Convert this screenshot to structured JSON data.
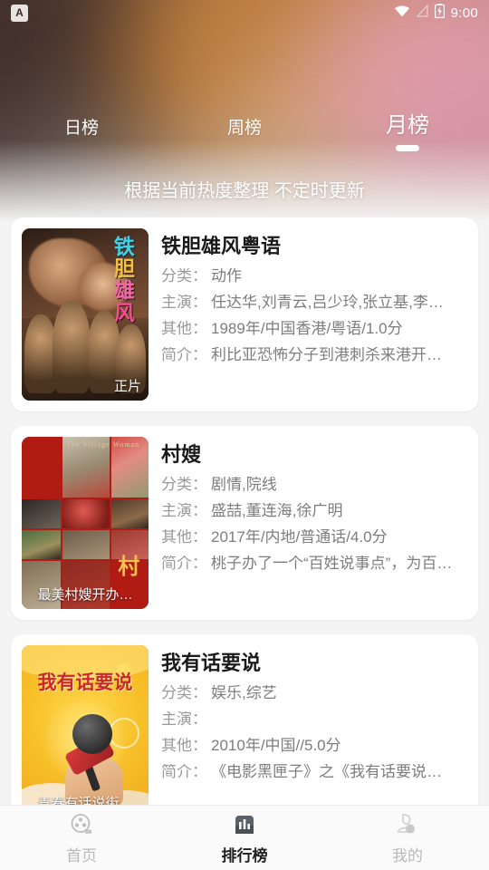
{
  "status_bar": {
    "app_badge": "A",
    "time": "9:00",
    "icons": [
      "wifi-icon",
      "signal-icon",
      "battery-charging-icon"
    ]
  },
  "header": {
    "tabs": [
      {
        "label": "日榜",
        "active": false
      },
      {
        "label": "周榜",
        "active": false
      },
      {
        "label": "月榜",
        "active": true
      }
    ],
    "subtitle": "根据当前热度整理 不定时更新"
  },
  "list": {
    "labels": {
      "category": "分类：",
      "cast": "主演：",
      "other": "其他：",
      "summary": "简介："
    },
    "items": [
      {
        "title": "铁胆雄风粤语",
        "poster_badge": "正片",
        "poster_title_chars": [
          "铁",
          "胆",
          "雄",
          "风"
        ],
        "category": "动作",
        "cast": "任达华,刘青云,吕少玲,张立基,李…",
        "other": "1989年/中国香港/粤语/1.0分",
        "summary": "利比亚恐怖分子到港刺杀来港开…"
      },
      {
        "title": "村嫂",
        "poster_badge": "最美村嫂开办…",
        "poster_top_text": "The  Village  Woman",
        "poster_mark": "村",
        "category": "剧情,院线",
        "cast": "盛喆,董连海,徐广明",
        "other": "2017年/内地/普通话/4.0分",
        "summary": "桃子办了一个“百姓说事点”，为百…"
      },
      {
        "title": "我有话要说",
        "poster_badge": "青春有话说街…",
        "poster_title": "我有话要说",
        "category": "娱乐,综艺",
        "cast": "",
        "other": "2010年/中国//5.0分",
        "summary": "《电影黑匣子》之《我有话要说…"
      }
    ]
  },
  "bottom_nav": {
    "items": [
      {
        "label": "首页",
        "icon": "film-reel-icon",
        "active": false
      },
      {
        "label": "排行榜",
        "icon": "bar-chart-icon",
        "active": true
      },
      {
        "label": "我的",
        "icon": "user-profile-icon",
        "active": false
      }
    ]
  },
  "colors": {
    "card_bg": "#ffffff",
    "page_bg": "#f4f4f4",
    "active_nav": "#1f1f1f",
    "inactive_nav": "#b9b9b9",
    "accent_white": "#ffffff"
  }
}
